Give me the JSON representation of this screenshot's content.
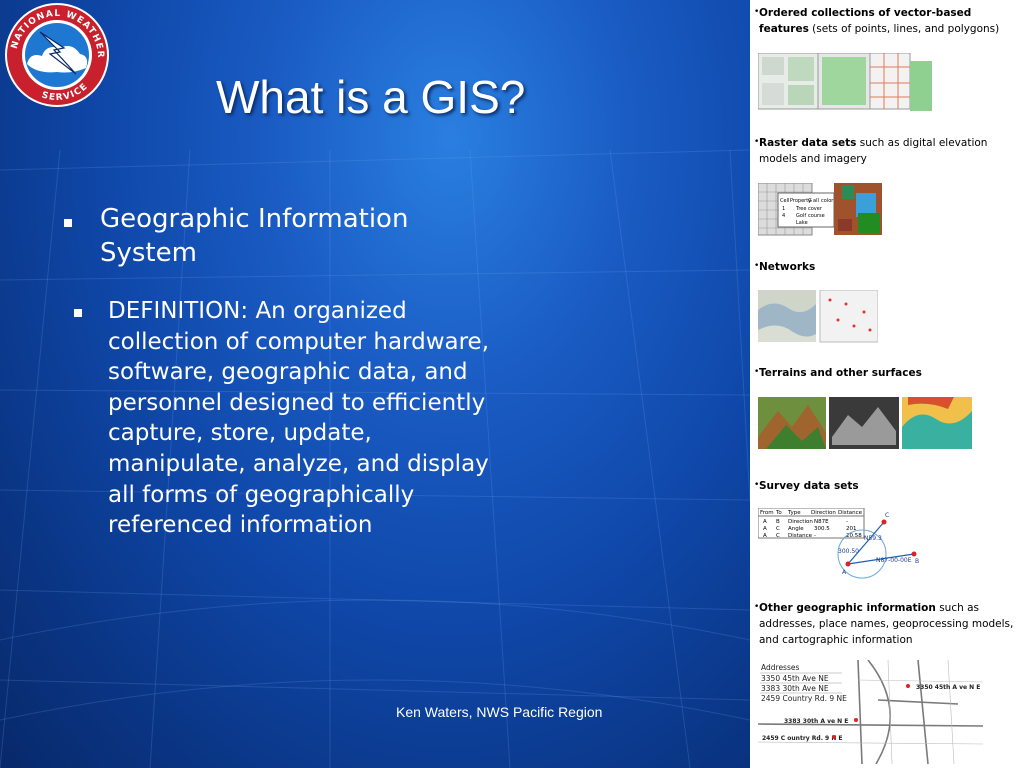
{
  "slide": {
    "title": "What is a GIS?",
    "bullets": [
      "Geographic Information System",
      "DEFINITION:  An organized collection of computer hardware, software, geographic data, and personnel designed to efficiently capture, store, update, manipulate, analyze, and display all forms of geographically referenced information"
    ],
    "footer": "Ken Waters, NWS Pacific Region",
    "logo_text": "NATIONAL WEATHER SERVICE"
  },
  "panel": {
    "sections": [
      {
        "bold": "Ordered collections of vector-based features",
        "rest": " (sets of points, lines, and polygons)"
      },
      {
        "bold": "Raster data sets",
        "rest": " such as digital elevation models and imagery"
      },
      {
        "bold": "Networks",
        "rest": ""
      },
      {
        "bold": "Terrains and other surfaces",
        "rest": ""
      },
      {
        "bold": "Survey data sets",
        "rest": ""
      },
      {
        "bold": "Other geographic information",
        "rest": " such as addresses, place names, geoprocessing models, and cartographic information"
      }
    ],
    "raster_table": {
      "headers": [
        "Cell",
        "Property",
        "G",
        "all",
        "color"
      ],
      "rows": [
        [
          "1",
          "Tree",
          "cover"
        ],
        [
          "4",
          "Golf",
          "course"
        ],
        [
          "",
          "Lake",
          ""
        ]
      ]
    },
    "survey_table": {
      "headers": [
        "From",
        "To",
        "Type",
        "Direction",
        "Distance"
      ],
      "rows": [
        [
          "A",
          "B",
          "Direction",
          "N87E",
          "-"
        ],
        [
          "A",
          "C",
          "Angle",
          "300.5",
          "201"
        ],
        [
          "A",
          "C",
          "Distance",
          "-",
          "20.58"
        ]
      ]
    },
    "survey_labels": [
      "A",
      "B",
      "C",
      "300.50",
      "N87-00-00E",
      "N59.3"
    ],
    "addresses": {
      "header": "Addresses",
      "items": [
        "3350 45th Ave NE",
        "3383 30th Ave NE",
        "2459 Country Rd. 9 NE"
      ],
      "map_labels": [
        "3350  45th A ve N E",
        "3383  30th A ve N E",
        "2459 C ountry  Rd.  9 N E"
      ]
    }
  }
}
